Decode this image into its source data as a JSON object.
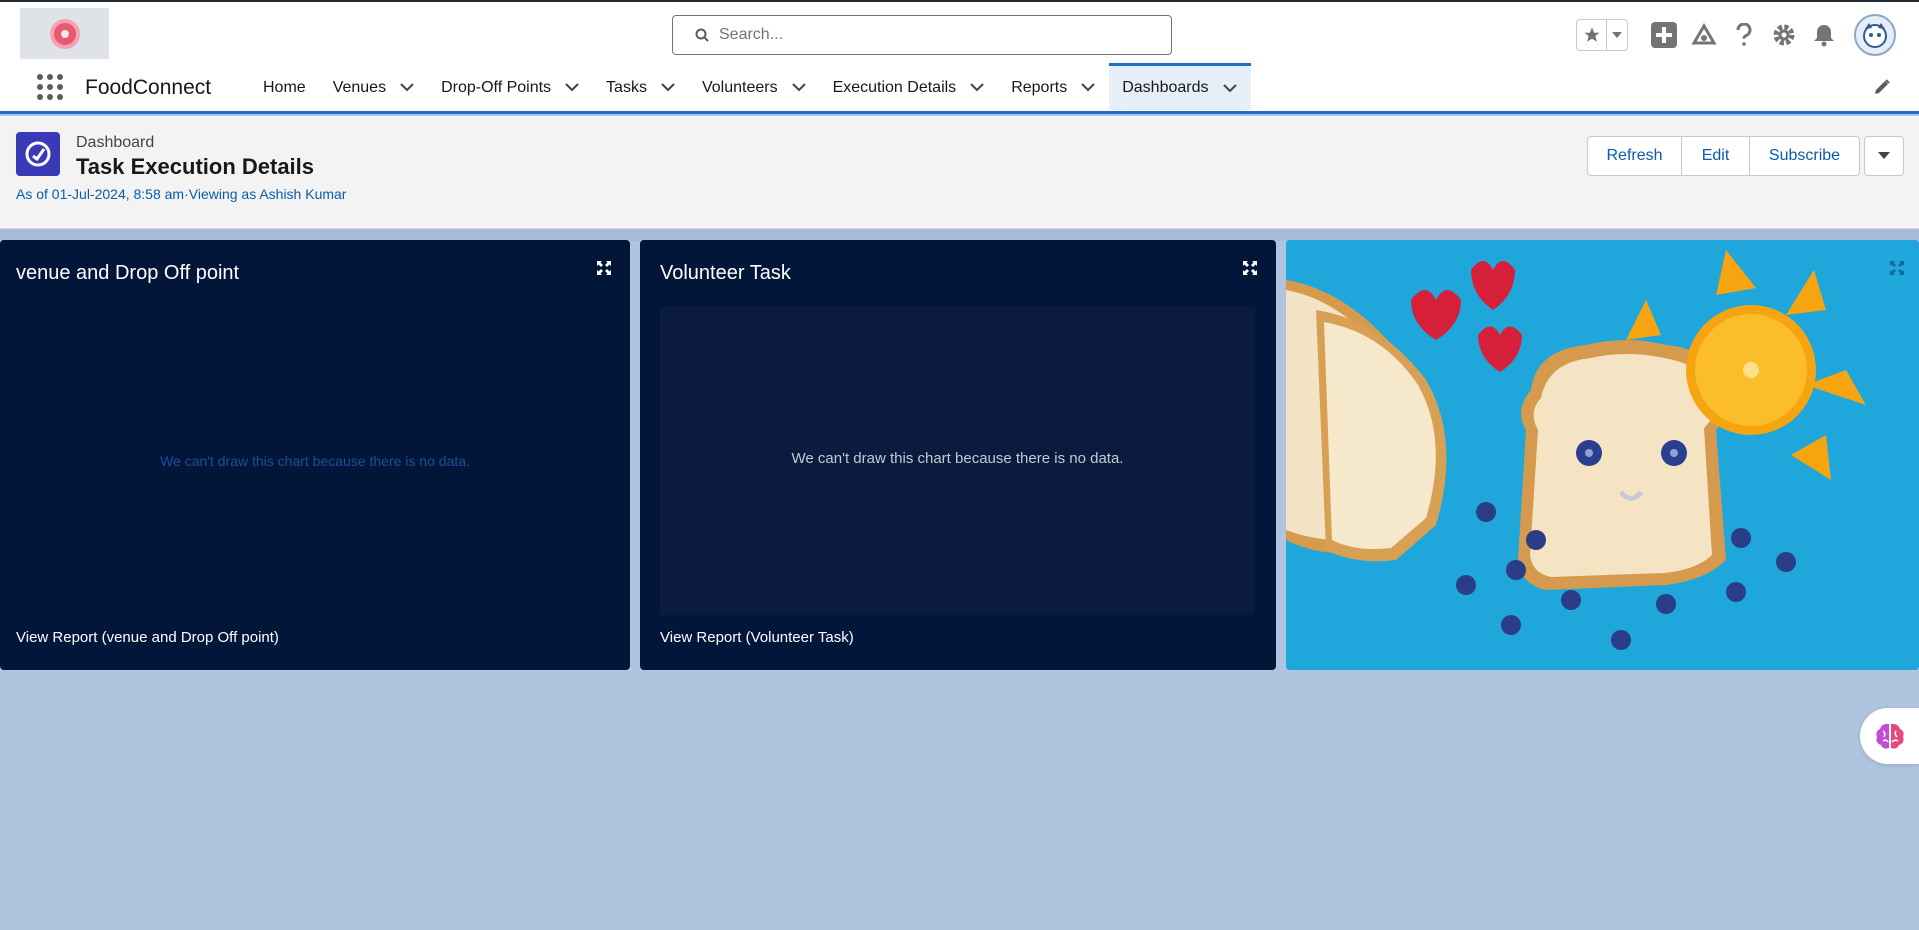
{
  "header": {
    "search_placeholder": "Search...",
    "icons": [
      "favorites-star-icon",
      "chevron-down-icon",
      "global-actions-plus-icon",
      "trailhead-icon",
      "help-icon",
      "setup-gear-icon",
      "notifications-bell-icon",
      "user-avatar"
    ]
  },
  "nav": {
    "app_name": "FoodConnect",
    "items": [
      {
        "label": "Home",
        "has_menu": false
      },
      {
        "label": "Venues",
        "has_menu": true
      },
      {
        "label": "Drop-Off Points",
        "has_menu": true
      },
      {
        "label": "Tasks",
        "has_menu": true
      },
      {
        "label": "Volunteers",
        "has_menu": true
      },
      {
        "label": "Execution Details",
        "has_menu": true
      },
      {
        "label": "Reports",
        "has_menu": true
      },
      {
        "label": "Dashboards",
        "has_menu": true,
        "active": true
      }
    ]
  },
  "page": {
    "object_type": "Dashboard",
    "title": "Task Execution Details",
    "as_of": "As of 01-Jul-2024, 8:58 am·Viewing as Ashish Kumar",
    "buttons": {
      "refresh": "Refresh",
      "edit": "Edit",
      "subscribe": "Subscribe"
    }
  },
  "widgets": [
    {
      "title": "venue and Drop Off point",
      "message": "We can't draw this chart because there is no data.",
      "link": "View Report (venue and Drop Off point)"
    },
    {
      "title": "Volunteer Task",
      "message": "We can't draw this chart because there is no data.",
      "link": "View Report (Volunteer Task)"
    },
    {
      "type": "image",
      "description_icon": "food-photo"
    }
  ],
  "colors": {
    "brand": "#1b6fc4",
    "widget_bg": "#011638",
    "dashboard_bg": "#b0c4df",
    "link": "#0b5cab"
  }
}
